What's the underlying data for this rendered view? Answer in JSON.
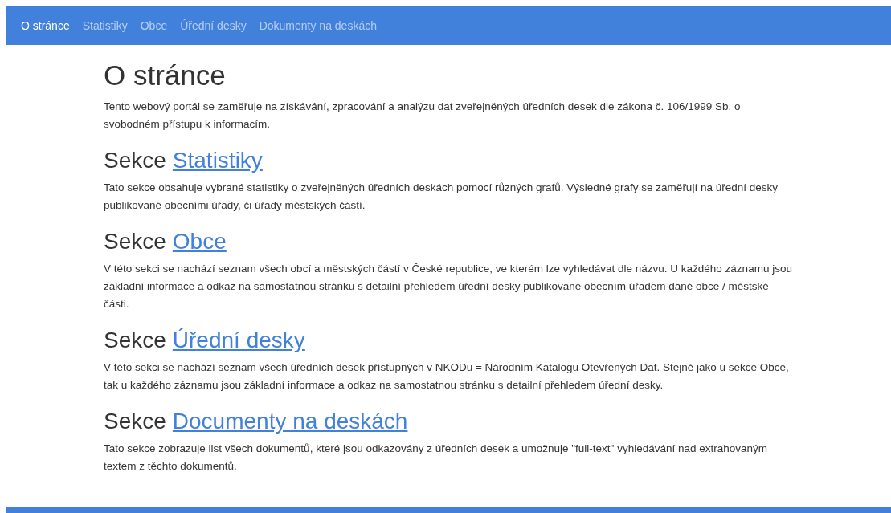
{
  "navbar": {
    "items": [
      {
        "label": "O stránce",
        "selected": true
      },
      {
        "label": "Statistiky",
        "selected": false
      },
      {
        "label": "Obce",
        "selected": false
      },
      {
        "label": "Úřední desky",
        "selected": false
      },
      {
        "label": "Dokumenty na deskách",
        "selected": false
      }
    ]
  },
  "page": {
    "title": "O stránce",
    "intro": "Tento webový portál se zaměřuje na získávání, zpracování a analýzu dat zveřejněných úředních desek dle zákona č. 106/1999 Sb. o svobodném přístupu k informacím.",
    "sections": [
      {
        "prefix": "Sekce",
        "link": "Statistiky",
        "text": "Tato sekce obsahuje vybrané statistiky o zveřejněných úředních deskách pomocí různých grafů. Výsledné grafy se zaměřují na úřední desky publikované obecními úřady, či úřady městských částí."
      },
      {
        "prefix": "Sekce",
        "link": "Obce",
        "text": "V této sekci se nachází seznam všech obcí a městských částí v České republice, ve kterém lze vyhledávat dle názvu. U každého záznamu jsou základní informace a odkaz na samostatnou stránku s detailní přehledem úřední desky publikované obecním úřadem dané obce / městské části."
      },
      {
        "prefix": "Sekce",
        "link": "Úřední desky",
        "text": "V této sekci se nachází seznam všech úředních desek přístupných v NKODu = Národním Katalogu Otevřených Dat. Stejně jako u sekce Obce, tak u každého záznamu jsou základní informace a odkaz na samostatnou stránku s detailní přehledem úřední desky."
      },
      {
        "prefix": "Sekce",
        "link": "Documenty na deskách",
        "text": "Tato sekce zobrazuje list všech dokumentů, které jsou odkazovány z úředních desek a umožnuje \"full-text\" vyhledávání nad extrahovaným textem z těchto dokumentů."
      }
    ]
  }
}
